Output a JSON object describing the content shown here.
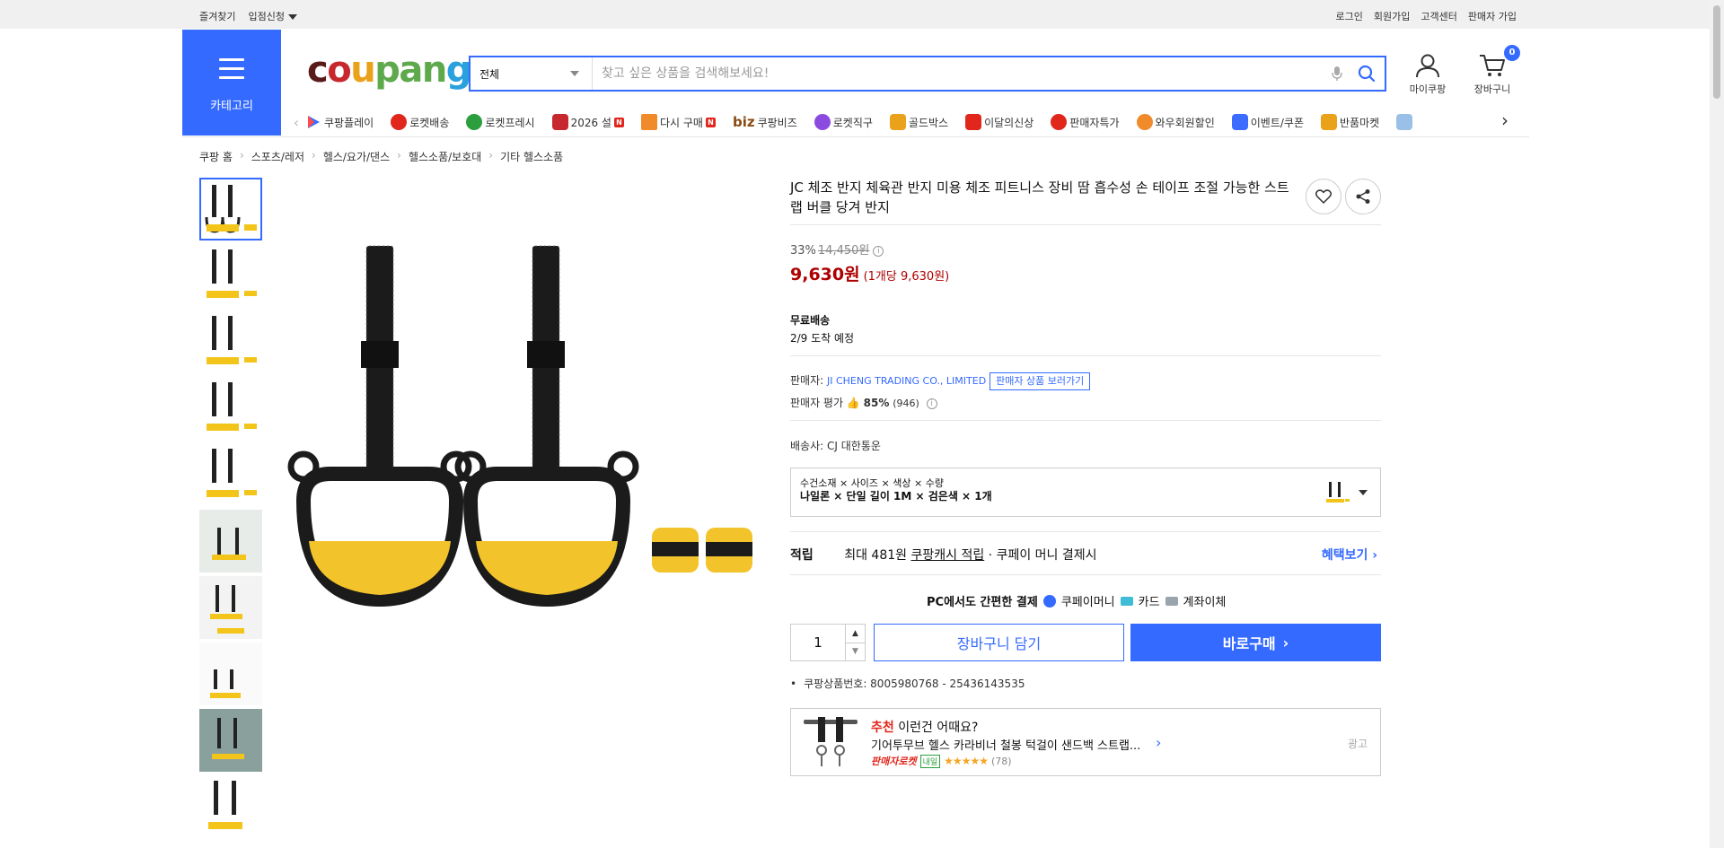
{
  "topbar": {
    "bookmark": "즐겨찾기",
    "store_apply": "입점신청",
    "login": "로그인",
    "signup": "회원가입",
    "customer_center": "고객센터",
    "seller_signup": "판매자 가입"
  },
  "header": {
    "category_label": "카테고리",
    "logo": [
      "c",
      "o",
      "u",
      "pan",
      "g"
    ],
    "search_scope": "전체",
    "search_placeholder": "찾고 싶은 상품을 검색해보세요!",
    "mycoupang_label": "마이쿠팡",
    "cart_label": "장바구니",
    "cart_count": "0"
  },
  "nav": {
    "items": [
      {
        "label": "쿠팡플레이",
        "color": "#3b6cff",
        "new": false
      },
      {
        "label": "로켓배송",
        "color": "#e1261c",
        "new": false
      },
      {
        "label": "로켓프레시",
        "color": "#2c9e3d",
        "new": false
      },
      {
        "label": "2026 설",
        "color": "#c7282e",
        "new": true
      },
      {
        "label": "다시 구매",
        "color": "#f08a2a",
        "new": true
      },
      {
        "label": "쿠팡비즈",
        "color": "#8a4a12",
        "new": false
      },
      {
        "label": "로켓직구",
        "color": "#8b4ae0",
        "new": false
      },
      {
        "label": "골드박스",
        "color": "#e9a21a",
        "new": false
      },
      {
        "label": "이달의신상",
        "color": "#e1261c",
        "new": false
      },
      {
        "label": "판매자특가",
        "color": "#e1261c",
        "new": false
      },
      {
        "label": "와우회원할인",
        "color": "#f08a2a",
        "new": false
      },
      {
        "label": "이벤트/쿠폰",
        "color": "#3b6cff",
        "new": false
      },
      {
        "label": "반품마켓",
        "color": "#e9a21a",
        "new": false
      }
    ],
    "biz_prefix": "biz",
    "new_badge": "N"
  },
  "breadcrumb": [
    "쿠팡 홈",
    "스포츠/레저",
    "헬스/요가/댄스",
    "헬스소품/보호대",
    "기타 헬스소품"
  ],
  "product": {
    "title": "JC 체조 반지 체육관 반지 미용 체조 피트니스 장비 땀 흡수성 손 테이프 조절 가능한 스트랩 버클 당겨 반지",
    "discount_rate": "33%",
    "original_price": "14,450원",
    "price": "9,630원",
    "unit_price": "(1개당 9,630원)",
    "shipping_label": "무료배송",
    "arrival": "2/9 도착 예정",
    "seller_label": "판매자:",
    "seller_name": "JI CHENG TRADING CO., LIMITED",
    "seller_products_btn": "판매자 상품 보러가기",
    "seller_rating_label": "판매자 평가",
    "seller_rating": "85%",
    "seller_rating_count": "(946)",
    "courier_label": "배송사:",
    "courier": "CJ 대한통운",
    "option_header": "수건소재 × 사이즈 × 색상 × 수량",
    "option_value": "나일론 × 단일 길이 1M × 검은색 × 1개",
    "points_label": "적립",
    "points_prefix": "최대 481원",
    "points_link": "쿠팡캐시 적립",
    "points_suffix": "· 쿠페이 머니 결제시",
    "benefit_link": "혜택보기",
    "pay_pc_label": "PC에서도 간편한 결제",
    "pay_options": [
      "쿠페이머니",
      "카드",
      "계좌이체"
    ],
    "quantity": "1",
    "add_cart": "장바구니 담기",
    "buy_now": "바로구매",
    "product_no": "쿠팡상품번호: 8005980768 - 25436143535"
  },
  "recommend": {
    "highlight": "추천",
    "title_rest": "이런건 어때요?",
    "item_name": "기어투무브 헬스 카라비너 철봉 턱걸이 샌드백 스트랩...",
    "badge": "판매자로켓",
    "tag": "내일",
    "stars": "★★★★★",
    "rating_value": 4.5,
    "review_count": "(78)",
    "ad_label": "광고"
  }
}
